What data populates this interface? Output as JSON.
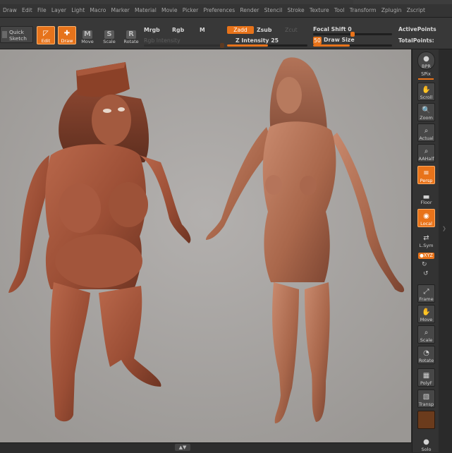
{
  "menu": [
    "Draw",
    "Edit",
    "File",
    "Layer",
    "Light",
    "Macro",
    "Marker",
    "Material",
    "Movie",
    "Picker",
    "Preferences",
    "Render",
    "Stencil",
    "Stroke",
    "Texture",
    "Tool",
    "Transform",
    "Zplugin",
    "Zscript"
  ],
  "shelf": {
    "quick_sketch_1": "Quick",
    "quick_sketch_2": "Sketch",
    "edit": "Edit",
    "draw": "Draw",
    "move": "Move",
    "scale": "Scale",
    "rotate": "Rotate",
    "mrgb": "Mrgb",
    "rgb": "Rgb",
    "m": "M",
    "rgb_intensity": "Rgb Intensity",
    "zadd": "Zadd",
    "zsub": "Zsub",
    "zcut": "Zcut",
    "z_intensity": "Z Intensity 25",
    "focal_shift": "Focal Shift 0",
    "draw_size_value": "50",
    "draw_size": "Draw Size",
    "active_points": "ActivePoints",
    "total_points": "TotalPoints:"
  },
  "tray": {
    "bpr": "BPR",
    "spix": "SPix",
    "scroll": "Scroll",
    "zoom": "Zoom",
    "actual": "Actual",
    "aahalf": "AAHalf",
    "persp": "Persp",
    "floor": "Floor",
    "local": "Local",
    "lsym": "L.Sym",
    "xyz": "●XYZ",
    "frame": "Frame",
    "move": "Move",
    "scale": "Scale",
    "rotate": "Rotate",
    "polyf": "PolyF",
    "transp": "Transp",
    "solo": "Solo"
  },
  "colors": {
    "accent": "#e8731a",
    "viewport_bg": "#a6a3a1",
    "skin": "#a5553c"
  },
  "icons": {
    "edit": "edit-pencil-icon",
    "draw": "draw-brush-icon",
    "move": "move-icon",
    "scale": "scale-icon",
    "rotate": "rotate-icon",
    "scroll": "hand-scroll-icon",
    "zoom": "magnifier-zoom-icon",
    "frame": "frame-icon"
  }
}
